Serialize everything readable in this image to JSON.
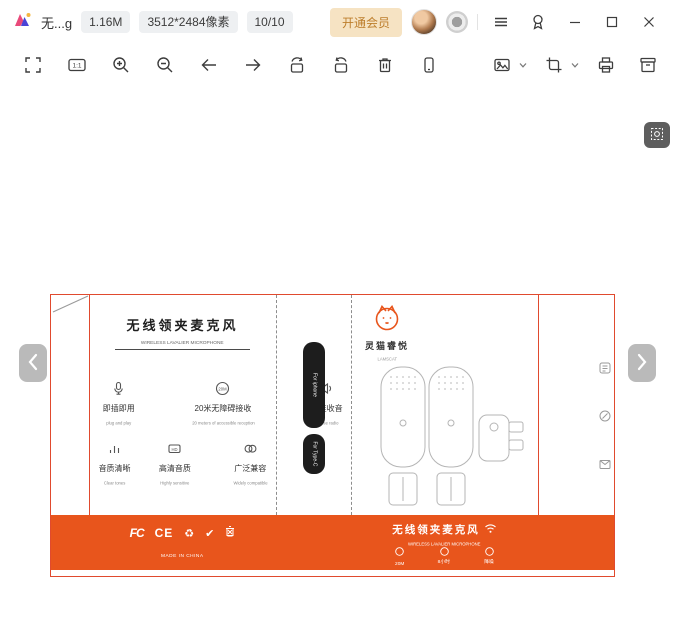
{
  "titlebar": {
    "filename": "无...g",
    "filesize": "1.16M",
    "dimensions": "3512*2484像素",
    "counter": "10/10",
    "membership": "开通会员"
  },
  "toolbar": {
    "one_to_one": "1:1"
  },
  "icons": {
    "recycle_glyph": "♻",
    "check_glyph": "✔",
    "twenty_m": "20M",
    "hd": "HD"
  },
  "package": {
    "front": {
      "title_cn": "无线领夹麦克风",
      "title_en": "WIRELESS LAVALIER MICROPHONE",
      "features": [
        {
          "cn": "即插即用",
          "en": "plug and play"
        },
        {
          "cn": "20米无障碍接收",
          "en": "20 meters of accessible reception"
        },
        {
          "cn": "精准收音",
          "en": "Precise radio"
        },
        {
          "cn": "音质清晰",
          "en": "Clear tones"
        },
        {
          "cn": "高清音质",
          "en": "Highly sensitive"
        },
        {
          "cn": "广泛兼容",
          "en": "Widely compatible"
        }
      ]
    },
    "spine": {
      "top": "For iphone",
      "bottom": "For Type-C"
    },
    "brand": {
      "cn": "灵猫睿悦",
      "en": "LAMSCAT"
    },
    "bottom": {
      "fcc": "FC",
      "ce": "CE",
      "made_in": "MADE IN CHINA",
      "title_cn": "无线领夹麦克风",
      "title_en": "WIRELESS LAVALIER MICROPHONE",
      "badges": [
        {
          "label": "20M"
        },
        {
          "label": "8小时"
        },
        {
          "label": "降噪"
        }
      ]
    }
  }
}
